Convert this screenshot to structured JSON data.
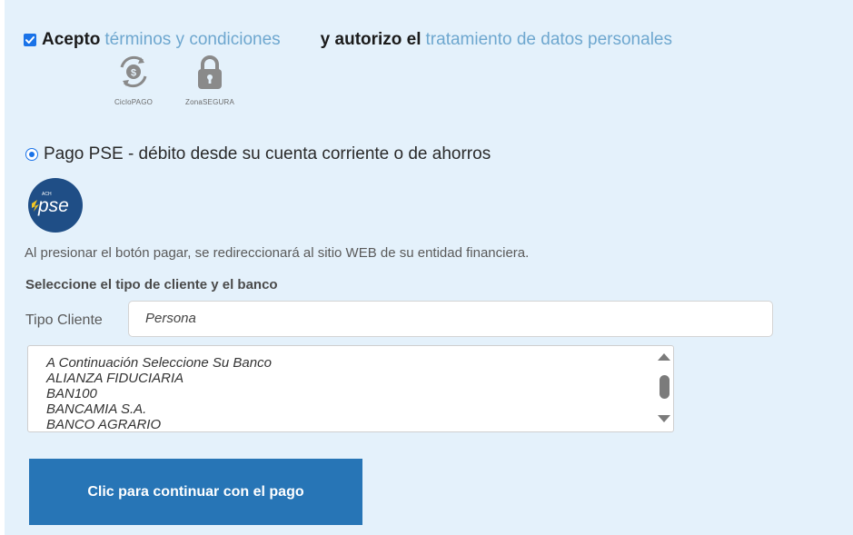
{
  "terms": {
    "checked": true,
    "accept_label": "Acepto",
    "terms_link": "términos y condiciones",
    "authorize_label": "y autorizo el",
    "data_link": "tratamiento de datos personales"
  },
  "badges": [
    {
      "icon": "cycle-payment-icon",
      "caption": "CicloPAGO"
    },
    {
      "icon": "padlock-icon",
      "caption": "ZonaSEGURA"
    }
  ],
  "payment_option": {
    "selected": true,
    "label": "Pago PSE - débito desde su cuenta corriente o de ahorros",
    "logo_text": "pse",
    "logo_small_text": "ACH"
  },
  "info_text": "Al presionar el botón pagar, se redireccionará al sitio WEB de su entidad financiera.",
  "section_title": "Seleccione el tipo de cliente y el banco",
  "client_type": {
    "label": "Tipo Cliente",
    "value": "Persona"
  },
  "bank_list": {
    "options": [
      "A Continuación Seleccione Su Banco",
      "ALIANZA FIDUCIARIA",
      "BAN100",
      "BANCAMIA S.A.",
      "BANCO AGRARIO"
    ]
  },
  "continue_button": "Clic para continuar con el pago",
  "colors": {
    "panel_bg": "#e4f1fb",
    "link": "#6ea7cf",
    "accent": "#1a73e8",
    "button_bg": "#2775b6",
    "pse_blue": "#1f4e86"
  }
}
